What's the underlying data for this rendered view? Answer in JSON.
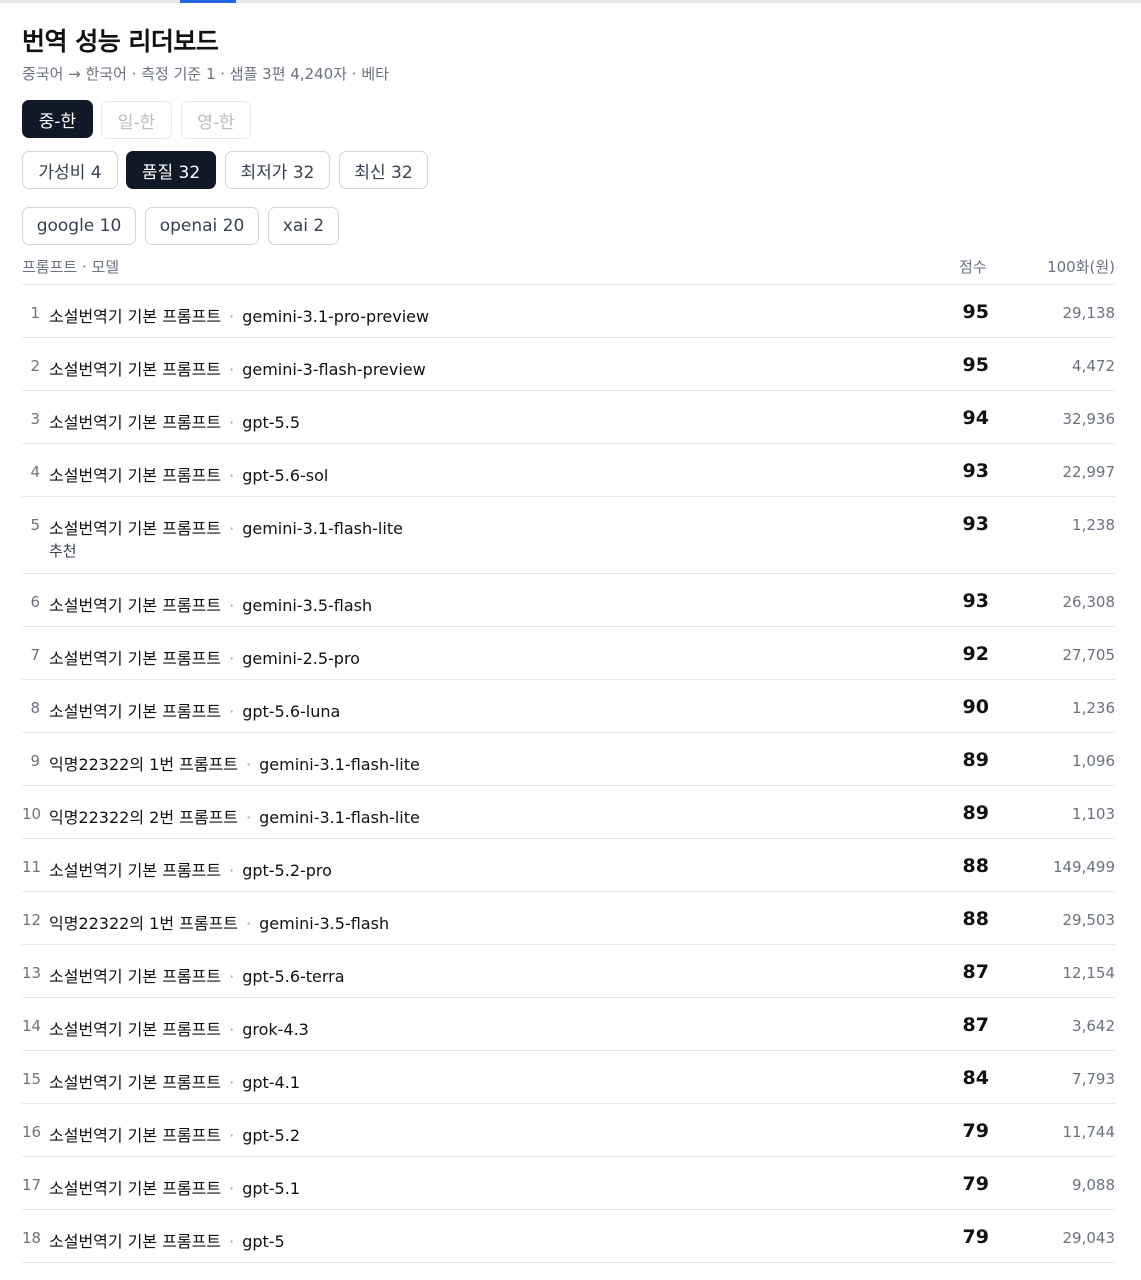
{
  "header": {
    "title": "번역 성능 리더보드",
    "subtitle": "중국어 → 한국어 · 측정 기준 1 · 샘플 3편 4,240자 · 베타"
  },
  "language_tabs": [
    {
      "label": "중-한",
      "state": "active"
    },
    {
      "label": "일-한",
      "state": "disabled"
    },
    {
      "label": "영-한",
      "state": "disabled"
    }
  ],
  "sort_tabs": [
    {
      "label": "가성비 4",
      "state": "normal"
    },
    {
      "label": "품질 32",
      "state": "active"
    },
    {
      "label": "최저가 32",
      "state": "normal"
    },
    {
      "label": "최신 32",
      "state": "normal"
    }
  ],
  "provider_filters": [
    {
      "label": "google 10"
    },
    {
      "label": "openai 20"
    },
    {
      "label": "xai 2"
    }
  ],
  "table": {
    "headers": {
      "prompt_model": "프롬프트 · 모델",
      "score": "점수",
      "cost": "100화(원)"
    },
    "separator": "·",
    "rows": [
      {
        "rank": "1",
        "prompt": "소설번역기 기본 프롬프트",
        "model": "gemini-3.1-pro-preview",
        "score": "95",
        "cost": "29,138"
      },
      {
        "rank": "2",
        "prompt": "소설번역기 기본 프롬프트",
        "model": "gemini-3-flash-preview",
        "score": "95",
        "cost": "4,472"
      },
      {
        "rank": "3",
        "prompt": "소설번역기 기본 프롬프트",
        "model": "gpt-5.5",
        "score": "94",
        "cost": "32,936"
      },
      {
        "rank": "4",
        "prompt": "소설번역기 기본 프롬프트",
        "model": "gpt-5.6-sol",
        "score": "93",
        "cost": "22,997"
      },
      {
        "rank": "5",
        "prompt": "소설번역기 기본 프롬프트",
        "model": "gemini-3.1-flash-lite",
        "badge": "추천",
        "score": "93",
        "cost": "1,238"
      },
      {
        "rank": "6",
        "prompt": "소설번역기 기본 프롬프트",
        "model": "gemini-3.5-flash",
        "score": "93",
        "cost": "26,308"
      },
      {
        "rank": "7",
        "prompt": "소설번역기 기본 프롬프트",
        "model": "gemini-2.5-pro",
        "score": "92",
        "cost": "27,705"
      },
      {
        "rank": "8",
        "prompt": "소설번역기 기본 프롬프트",
        "model": "gpt-5.6-luna",
        "score": "90",
        "cost": "1,236"
      },
      {
        "rank": "9",
        "prompt": "익명22322의 1번 프롬프트",
        "model": "gemini-3.1-flash-lite",
        "score": "89",
        "cost": "1,096"
      },
      {
        "rank": "10",
        "prompt": "익명22322의 2번 프롬프트",
        "model": "gemini-3.1-flash-lite",
        "score": "89",
        "cost": "1,103"
      },
      {
        "rank": "11",
        "prompt": "소설번역기 기본 프롬프트",
        "model": "gpt-5.2-pro",
        "score": "88",
        "cost": "149,499"
      },
      {
        "rank": "12",
        "prompt": "익명22322의 1번 프롬프트",
        "model": "gemini-3.5-flash",
        "score": "88",
        "cost": "29,503"
      },
      {
        "rank": "13",
        "prompt": "소설번역기 기본 프롬프트",
        "model": "gpt-5.6-terra",
        "score": "87",
        "cost": "12,154"
      },
      {
        "rank": "14",
        "prompt": "소설번역기 기본 프롬프트",
        "model": "grok-4.3",
        "score": "87",
        "cost": "3,642"
      },
      {
        "rank": "15",
        "prompt": "소설번역기 기본 프롬프트",
        "model": "gpt-4.1",
        "score": "84",
        "cost": "7,793"
      },
      {
        "rank": "16",
        "prompt": "소설번역기 기본 프롬프트",
        "model": "gpt-5.2",
        "score": "79",
        "cost": "11,744"
      },
      {
        "rank": "17",
        "prompt": "소설번역기 기본 프롬프트",
        "model": "gpt-5.1",
        "score": "79",
        "cost": "9,088"
      },
      {
        "rank": "18",
        "prompt": "소설번역기 기본 프롬프트",
        "model": "gpt-5",
        "score": "79",
        "cost": "29,043"
      }
    ]
  }
}
